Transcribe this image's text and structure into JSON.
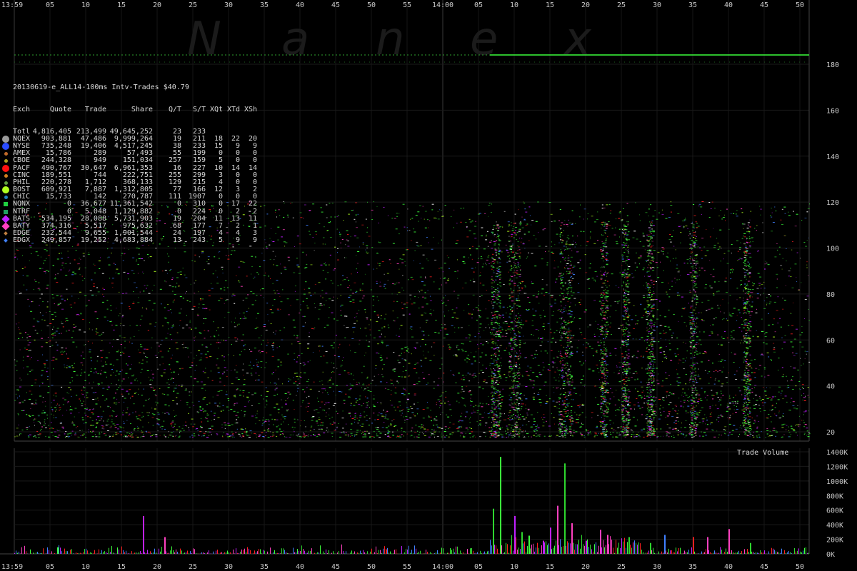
{
  "chart_data": {
    "type": "scatter",
    "title": "20130619-e_ALL14-100ms Intv-Trades $40.79",
    "x_time_labels": [
      "13:59",
      "05",
      "10",
      "15",
      "20",
      "25",
      "30",
      "35",
      "40",
      "45",
      "50",
      "55",
      "14:00",
      "05",
      "10",
      "15",
      "20",
      "25",
      "30",
      "35",
      "40",
      "45",
      "50"
    ],
    "watermark": [
      "N",
      "a",
      "n",
      "e",
      "x"
    ],
    "price_axis": {
      "ticks": [
        20,
        40,
        60,
        80,
        100,
        120,
        140,
        160,
        180
      ],
      "ylim": [
        0,
        185
      ]
    },
    "volume_axis": {
      "title": "Trade Volume",
      "ticks": [
        "0K",
        "200K",
        "400K",
        "600K",
        "800K",
        "1000K",
        "1200K",
        "1400K"
      ],
      "ylim": [
        0,
        1400
      ]
    },
    "volume_spikes_k": [
      {
        "sec": 18,
        "v": 520
      },
      {
        "sec": 21,
        "v": 230
      },
      {
        "sec": 6,
        "v": 90
      },
      {
        "sec": 52,
        "v": 60
      },
      {
        "sec": 67,
        "v": 620
      },
      {
        "sec": 68,
        "v": 1330
      },
      {
        "sec": 70,
        "v": 520
      },
      {
        "sec": 71,
        "v": 300
      },
      {
        "sec": 72,
        "v": 250
      },
      {
        "sec": 74,
        "v": 180
      },
      {
        "sec": 75,
        "v": 360
      },
      {
        "sec": 76,
        "v": 660
      },
      {
        "sec": 77,
        "v": 1240
      },
      {
        "sec": 78,
        "v": 420
      },
      {
        "sec": 80,
        "v": 180
      },
      {
        "sec": 82,
        "v": 330
      },
      {
        "sec": 83,
        "v": 260
      },
      {
        "sec": 86,
        "v": 230
      },
      {
        "sec": 89,
        "v": 150
      },
      {
        "sec": 91,
        "v": 260
      },
      {
        "sec": 95,
        "v": 230
      },
      {
        "sec": 97,
        "v": 230
      },
      {
        "sec": 100,
        "v": 340
      },
      {
        "sec": 103,
        "v": 150
      }
    ],
    "table": {
      "headers": [
        "Exch",
        "Quote",
        "Trade",
        "Share",
        "Q/T",
        "S/T",
        "XQt",
        "XTd",
        "XSh"
      ],
      "rows": [
        {
          "name": "Totl",
          "color": "",
          "marker": "none",
          "cells": [
            "4,816,405",
            "213,499",
            "49,645,252",
            "23",
            "233",
            "",
            "",
            ""
          ]
        },
        {
          "name": "NQEX",
          "color": "#9a9a9a",
          "marker": "circle-lg",
          "cells": [
            "903,881",
            "47,486",
            "9,999,264",
            "19",
            "211",
            "18",
            "22",
            "20"
          ]
        },
        {
          "name": "NYSE",
          "color": "#2a4bff",
          "marker": "circle-lg",
          "cells": [
            "735,248",
            "19,406",
            "4,517,245",
            "38",
            "233",
            "15",
            "9",
            "9"
          ]
        },
        {
          "name": "AMEX",
          "color": "#c06a2a",
          "marker": "circle",
          "cells": [
            "15,786",
            "289",
            "57,493",
            "55",
            "199",
            "0",
            "0",
            "0"
          ]
        },
        {
          "name": "CBOE",
          "color": "#b0a020",
          "marker": "circle",
          "cells": [
            "244,328",
            "949",
            "151,034",
            "257",
            "159",
            "5",
            "0",
            "0"
          ]
        },
        {
          "name": "PACF",
          "color": "#ff1010",
          "marker": "circle-lg",
          "cells": [
            "490,767",
            "30,647",
            "6,961,353",
            "16",
            "227",
            "10",
            "14",
            "14"
          ]
        },
        {
          "name": "CINC",
          "color": "#d08020",
          "marker": "circle",
          "cells": [
            "189,551",
            "744",
            "222,751",
            "255",
            "299",
            "3",
            "0",
            "0"
          ]
        },
        {
          "name": "PHIL",
          "color": "#60a040",
          "marker": "circle",
          "cells": [
            "220,278",
            "1,712",
            "368,133",
            "129",
            "215",
            "4",
            "0",
            "0"
          ]
        },
        {
          "name": "BOST",
          "color": "#b0ff20",
          "marker": "circle-lg",
          "cells": [
            "609,921",
            "7,887",
            "1,312,805",
            "77",
            "166",
            "12",
            "3",
            "2"
          ]
        },
        {
          "name": "CHIC",
          "color": "#2080c0",
          "marker": "circle",
          "cells": [
            "15,733",
            "142",
            "270,787",
            "111",
            "1907",
            "0",
            "0",
            "0"
          ]
        },
        {
          "name": "NQNX",
          "color": "#20d040",
          "marker": "square",
          "cells": [
            "0",
            "36,677",
            "11,361,542",
            "0",
            "310",
            "0",
            "17",
            "22"
          ]
        },
        {
          "name": "NTRF",
          "color": "#20a060",
          "marker": "square",
          "cells": [
            "0",
            "5,048",
            "1,129,882",
            "0",
            "224",
            "0",
            "2",
            "2"
          ]
        },
        {
          "name": "BATS",
          "color": "#c020ff",
          "marker": "diamond",
          "cells": [
            "534,195",
            "28,088",
            "5,731,903",
            "19",
            "204",
            "11",
            "13",
            "11"
          ]
        },
        {
          "name": "BATY",
          "color": "#ff40c0",
          "marker": "diamond",
          "cells": [
            "374,316",
            "5,517",
            "975,632",
            "68",
            "177",
            "7",
            "2",
            "1"
          ]
        },
        {
          "name": "EDGE",
          "color": "#c08040",
          "marker": "diamond-sm",
          "cells": [
            "232,544",
            "9,655",
            "1,901,544",
            "24",
            "197",
            "4",
            "4",
            "3"
          ]
        },
        {
          "name": "EDGX",
          "color": "#4080ff",
          "marker": "diamond-sm",
          "cells": [
            "249,857",
            "19,252",
            "4,683,884",
            "13",
            "243",
            "5",
            "9",
            "9"
          ]
        }
      ]
    }
  }
}
